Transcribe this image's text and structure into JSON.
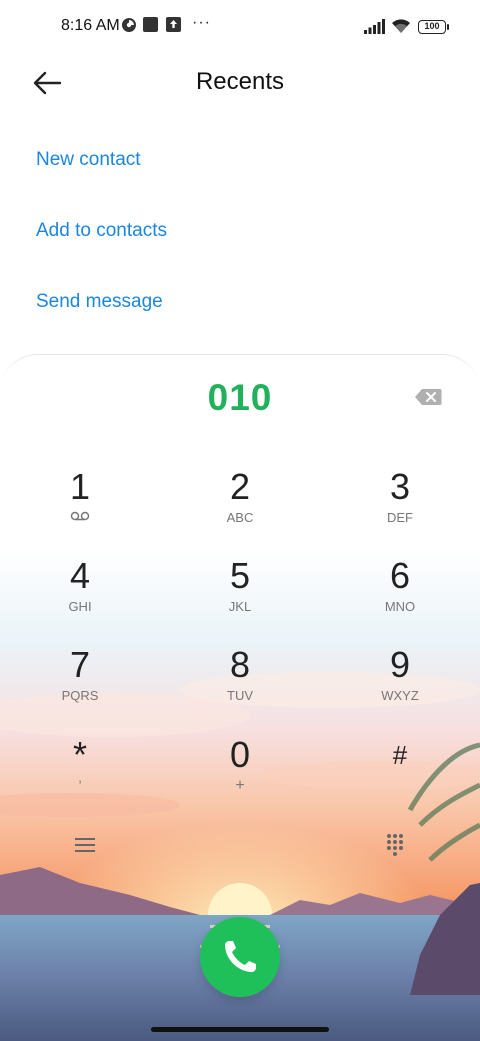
{
  "status_bar": {
    "time": "8:16 AM",
    "more": "···",
    "battery": "100",
    "icons": [
      "data-saver-icon",
      "square-notification-icon",
      "upload-notification-icon",
      "signal-icon",
      "wifi-icon",
      "battery-icon"
    ]
  },
  "header": {
    "back_icon": "arrow-left-icon",
    "title": "Recents"
  },
  "actions": [
    {
      "label": "New contact"
    },
    {
      "label": "Add to contacts"
    },
    {
      "label": "Send message"
    }
  ],
  "dialer": {
    "number": "010",
    "backspace_icon": "backspace-icon",
    "keys": [
      {
        "digit": "1",
        "letters": "",
        "sub_icon": "voicemail-icon"
      },
      {
        "digit": "2",
        "letters": "ABC"
      },
      {
        "digit": "3",
        "letters": "DEF"
      },
      {
        "digit": "4",
        "letters": "GHI"
      },
      {
        "digit": "5",
        "letters": "JKL"
      },
      {
        "digit": "6",
        "letters": "MNO"
      },
      {
        "digit": "7",
        "letters": "PQRS"
      },
      {
        "digit": "8",
        "letters": "TUV"
      },
      {
        "digit": "9",
        "letters": "WXYZ"
      },
      {
        "digit": "*",
        "letters": ","
      },
      {
        "digit": "0",
        "letters": "+"
      },
      {
        "digit": "#",
        "letters": ""
      }
    ],
    "menu_icon": "menu-icon",
    "keypad_toggle_icon": "keypad-icon",
    "call_icon": "phone-icon"
  },
  "colors": {
    "accent_blue": "#1a86e0",
    "number_green": "#20b15a",
    "call_green": "#1fc05a"
  }
}
